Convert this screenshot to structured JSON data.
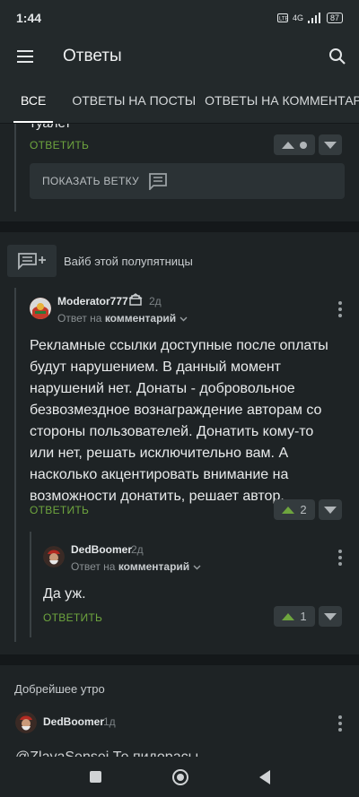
{
  "status_bar": {
    "time": "1:44",
    "network": "4G",
    "battery": "87"
  },
  "app_bar": {
    "title": "Ответы",
    "menu_icon": "hamburger-menu-icon",
    "search_icon": "search-icon"
  },
  "tabs": [
    {
      "label": "ВСЕ",
      "active": true
    },
    {
      "label": "ОТВЕТЫ НА ПОСТЫ",
      "active": false
    },
    {
      "label": "ОТВЕТЫ НА КОММЕНТАРИИ",
      "active": false
    }
  ],
  "top_fragment": {
    "text": "туалет",
    "reply_label": "ОТВЕТИТЬ",
    "show_branch_label": "ПОКАЗАТЬ ВЕТКУ"
  },
  "post1": {
    "title": "Вайб этой полупятницы",
    "comment": {
      "username": "Moderator777",
      "time": "2д",
      "meta_prefix": "Ответ на",
      "meta_target": "комментарий",
      "text": "Рекламные ссылки доступные после оплаты будут нарушением. В данный момент нарушений нет. Донаты - добровольное безвозмездное вознаграждение авторам со стороны пользователей. Донатить кому-то или нет, решать исключительно вам. А насколько акцентировать внимание на возможности донатить, решает автор.",
      "reply_label": "ОТВЕТИТЬ",
      "votes": "2"
    },
    "reply": {
      "username": "DedBoomer",
      "time": "2д",
      "meta_prefix": "Ответ на",
      "meta_target": "комментарий",
      "text": "Да уж.",
      "reply_label": "ОТВЕТИТЬ",
      "votes": "1"
    }
  },
  "post2": {
    "title": "Добрейшее утро",
    "comment": {
      "username": "DedBoomer",
      "time": "1д",
      "text_partial": "@ZlayaSensei  Те пидорасы"
    }
  },
  "colors": {
    "accent_green": "#6ea53e",
    "background": "#1e2325",
    "bar": "#23292b"
  }
}
